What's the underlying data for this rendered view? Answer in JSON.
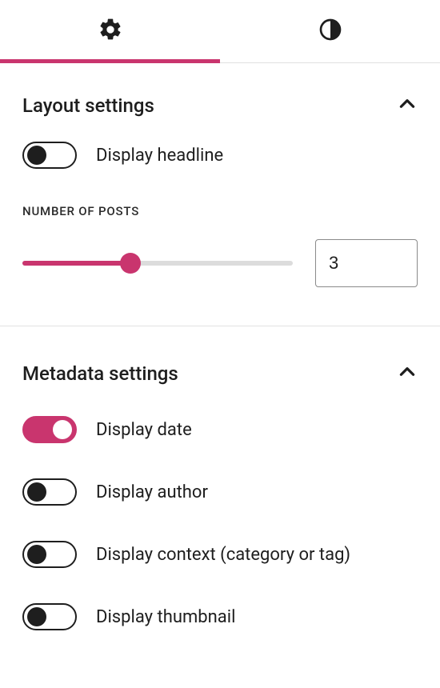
{
  "accent": "#c9356e",
  "tabs": {
    "settings_icon": "gear-icon",
    "styles_icon": "contrast-icon",
    "active_index": 0
  },
  "layout": {
    "title": "Layout settings",
    "display_headline": {
      "label": "Display headline",
      "on": false
    },
    "number_of_posts": {
      "label": "NUMBER OF POSTS",
      "value": "3",
      "slider_percent": 40
    }
  },
  "metadata": {
    "title": "Metadata settings",
    "items": [
      {
        "label": "Display date",
        "on": true
      },
      {
        "label": "Display author",
        "on": false
      },
      {
        "label": "Display context (category or tag)",
        "on": false
      },
      {
        "label": "Display thumbnail",
        "on": false
      }
    ]
  }
}
